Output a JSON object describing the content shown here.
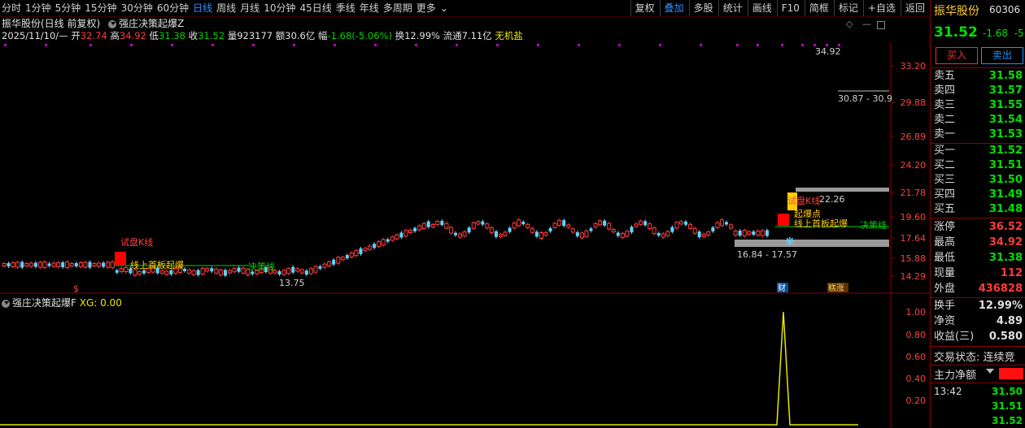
{
  "toolbar": {
    "periods": [
      "分时",
      "1分钟",
      "5分钟",
      "15分钟",
      "30分钟",
      "60分钟",
      "日线",
      "周线",
      "月线",
      "10分钟",
      "45日线",
      "季线",
      "年线",
      "多周期",
      "更多"
    ],
    "active_period": "日线",
    "right_buttons": [
      "复权",
      "叠加",
      "多股",
      "统计",
      "画线",
      "F10",
      "简框",
      "标记",
      "+自选",
      "返回"
    ],
    "right_active": "叠加"
  },
  "header": {
    "stock_label": "振华股份(日线 前复权)",
    "indicator_name": "强庄决策起爆Z",
    "date": "2025/11/10/—",
    "open_label": "开",
    "open": "32.74",
    "high_label": "高",
    "high": "34.92",
    "low_label": "低",
    "low": "31.38",
    "close_label": "收",
    "close": "31.52",
    "volume_label": "量",
    "volume": "923177",
    "amount_label": "额",
    "amount": "30.6亿",
    "change_label": "幅",
    "change": "-1.68(-5.06%)",
    "turnover_label": "换",
    "turnover": "12.99%",
    "float_label": "流通",
    "float_value": "7.11亿",
    "salt_text": "无机盐"
  },
  "main_chart": {
    "price_axis": [
      "33.20",
      "29.88",
      "26.89",
      "24.20",
      "21.78",
      "19.60",
      "17.64",
      "15.88",
      "14.29"
    ],
    "annotations": {
      "max_label": "34.92",
      "min_label": "13.75",
      "range_top": "30.87 - 30.9",
      "range_mid": "16.84 - 17.57",
      "pivot_level": "22.26",
      "trial_k1": "试盘K线",
      "trial_k2": "试盘K线",
      "first_board1": "线上首板起爆",
      "first_board2": "线上首板起爆",
      "decision1": "决策线",
      "decision2": "决策线",
      "explode_point": "起爆点",
      "s_marker": "$",
      "fin_tag": "财",
      "tag2": "糕涨"
    }
  },
  "sub_chart": {
    "title": "强庄决策起爆F",
    "series_label": "XG: 0.00",
    "axis": [
      "1.00",
      "0.80",
      "0.60",
      "0.40",
      "0.20"
    ]
  },
  "panel": {
    "name": "振华股份",
    "code": "60306",
    "price": "31.52",
    "change": "-1.68",
    "change_pct": "-5.",
    "buy_label": "买入",
    "sell_label": "卖出",
    "asks": [
      {
        "label": "卖五",
        "price": "31.58"
      },
      {
        "label": "卖四",
        "price": "31.57"
      },
      {
        "label": "卖三",
        "price": "31.55"
      },
      {
        "label": "卖二",
        "price": "31.54"
      },
      {
        "label": "卖一",
        "price": "31.53"
      }
    ],
    "bids": [
      {
        "label": "买一",
        "price": "31.52"
      },
      {
        "label": "买二",
        "price": "31.51"
      },
      {
        "label": "买三",
        "price": "31.50"
      },
      {
        "label": "买四",
        "price": "31.49"
      },
      {
        "label": "买五",
        "price": "31.48"
      }
    ],
    "stats1": [
      {
        "label": "涨停",
        "value": "36.52",
        "color": "#ff3b3b"
      },
      {
        "label": "最高",
        "value": "34.92",
        "color": "#ff3b3b"
      },
      {
        "label": "最低",
        "value": "31.38",
        "color": "#00e000"
      },
      {
        "label": "现量",
        "value": "112",
        "color": "#ff3b3b"
      },
      {
        "label": "外盘",
        "value": "436828",
        "color": "#ff3b3b"
      }
    ],
    "stats2": [
      {
        "label": "换手",
        "value": "12.99%",
        "color": "#e0e0e0"
      },
      {
        "label": "净资",
        "value": "4.89",
        "color": "#e0e0e0"
      },
      {
        "label": "收益(三)",
        "value": "0.580",
        "color": "#e0e0e0"
      }
    ],
    "trade_state": "交易状态: 连续竞",
    "main_flow": "主力净额",
    "ticks": [
      {
        "time": "13:42",
        "price": "31.50"
      },
      {
        "time": "",
        "price": "31.51"
      },
      {
        "time": "",
        "price": "31.52"
      }
    ]
  },
  "colors": {
    "up": "#ff3b3b",
    "down": "#5fd4ff",
    "ma": "#00d200",
    "accent": "#2f8cff"
  }
}
